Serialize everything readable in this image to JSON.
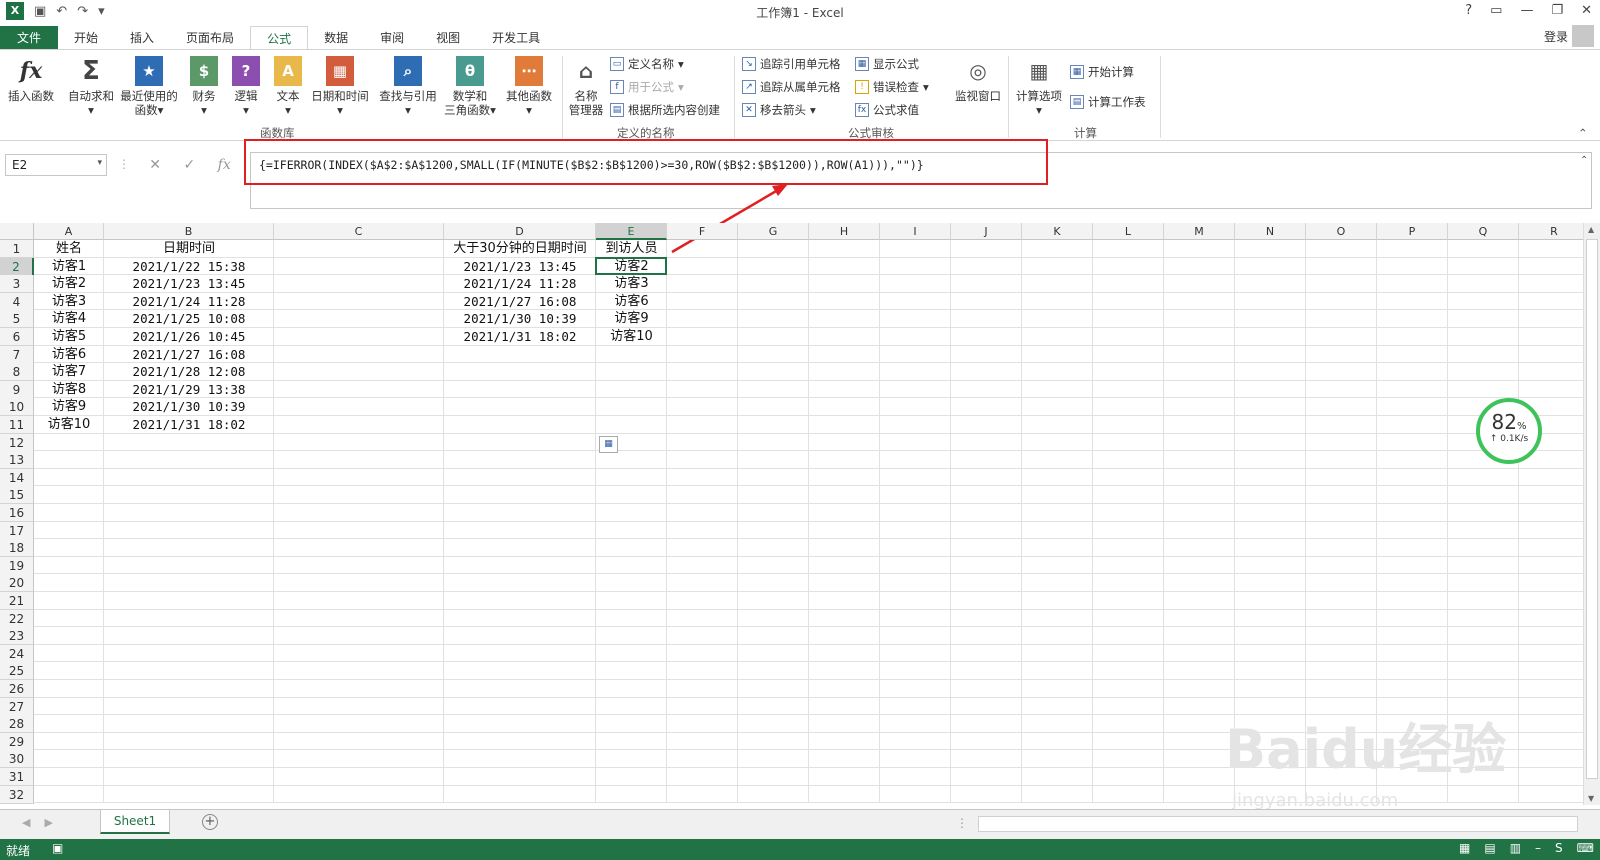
{
  "window": {
    "title": "工作簿1 - Excel",
    "login": "登录"
  },
  "tabs": [
    "文件",
    "开始",
    "插入",
    "页面布局",
    "公式",
    "数据",
    "审阅",
    "视图",
    "开发工具"
  ],
  "active_tab": "公式",
  "ribbon": {
    "function_library": {
      "insert_function": "插入函数",
      "autosum": "自动求和",
      "recent": "最近使用的",
      "recent2": "函数",
      "financial": "财务",
      "logical": "逻辑",
      "text": "文本",
      "datetime": "日期和时间",
      "lookup": "查找与引用",
      "math": "数学和",
      "math2": "三角函数",
      "other": "其他函数",
      "group_label": "函数库"
    },
    "defined_names": {
      "name_manager": "名称",
      "name_manager2": "管理器",
      "define_name": "定义名称",
      "use_in_formula": "用于公式",
      "create_from_selection": "根据所选内容创建",
      "group_label": "定义的名称"
    },
    "formula_auditing": {
      "trace_precedents": "追踪引用单元格",
      "trace_dependents": "追踪从属单元格",
      "remove_arrows": "移去箭头",
      "show_formulas": "显示公式",
      "error_checking": "错误检查",
      "evaluate_formula": "公式求值",
      "watch_window": "监视窗口",
      "group_label": "公式审核"
    },
    "calculation": {
      "calc_options": "计算选项",
      "calc_now": "开始计算",
      "calc_sheet": "计算工作表",
      "group_label": "计算"
    }
  },
  "formula_bar": {
    "name_box": "E2",
    "formula": "{=IFERROR(INDEX($A$2:$A$1200,SMALL(IF(MINUTE($B$2:$B$1200)>=30,ROW($B$2:$B$1200)),ROW(A1))),\"\")}"
  },
  "columns": [
    "A",
    "B",
    "C",
    "D",
    "E",
    "F",
    "G",
    "H",
    "I",
    "J",
    "K",
    "L",
    "M",
    "N",
    "O",
    "P",
    "Q",
    "R"
  ],
  "rows": [
    "1",
    "2",
    "3",
    "4",
    "5",
    "6",
    "7",
    "8",
    "9",
    "10",
    "11",
    "12",
    "13",
    "14",
    "15",
    "16",
    "17",
    "18",
    "19",
    "20",
    "21",
    "22",
    "23",
    "24",
    "25",
    "26",
    "27",
    "28",
    "29",
    "30",
    "31",
    "32"
  ],
  "cells": {
    "A": [
      "姓名",
      "访客1",
      "访客2",
      "访客3",
      "访客4",
      "访客5",
      "访客6",
      "访客7",
      "访客8",
      "访客9",
      "访客10"
    ],
    "B": [
      "日期时间",
      "2021/1/22 15:38",
      "2021/1/23 13:45",
      "2021/1/24 11:28",
      "2021/1/25 10:08",
      "2021/1/26 10:45",
      "2021/1/27 16:08",
      "2021/1/28 12:08",
      "2021/1/29 13:38",
      "2021/1/30 10:39",
      "2021/1/31 18:02"
    ],
    "D": [
      "大于30分钟的日期时间",
      "2021/1/23 13:45",
      "2021/1/24 11:28",
      "2021/1/27 16:08",
      "2021/1/30 10:39",
      "2021/1/31 18:02"
    ],
    "E": [
      "到访人员",
      "访客2",
      "访客3",
      "访客6",
      "访客9",
      "访客10"
    ]
  },
  "sheet_tab": "Sheet1",
  "status": {
    "ready": "就绪"
  },
  "widget": {
    "percent": "82",
    "percent_unit": "%",
    "speed": "↑ 0.1K/s"
  },
  "watermark": {
    "main": "Baidu经验",
    "sub": "jingyan.baidu.com"
  },
  "accent_color": "#217346",
  "annotation_color": "#e02020"
}
